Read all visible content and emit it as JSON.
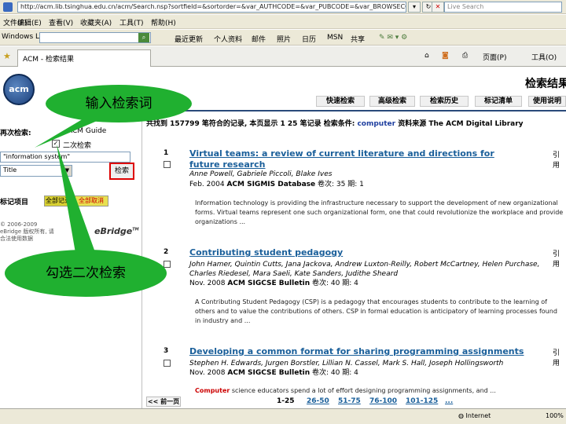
{
  "browser": {
    "url": "http://acm.lib.tsinghua.edu.cn/acm/Search.nsp?sortfield=&sortorder=&var_AUTHCODE=&var_PUBCODE=&var_BROWSECODE",
    "live_search_placeholder": "Live Search",
    "menu": [
      "文件(F)",
      "编辑(E)",
      "查看(V)",
      "收藏夹(A)",
      "工具(T)",
      "帮助(H)"
    ],
    "toolbar_brand": "Windows Live",
    "toolbar_items": [
      "最近更新",
      "个人资料",
      "邮件",
      "照片",
      "日历",
      "MSN",
      "共享"
    ],
    "tab_title": "ACM - 检索结果",
    "tab_tools": [
      "页面(P)",
      "工具(O)"
    ],
    "status_zone": "Internet",
    "status_zoom": "100%"
  },
  "header": {
    "logo": "acm",
    "page_title": "检索结果",
    "nav": [
      "快速检索",
      "高级检索",
      "检索历史",
      "标记清单",
      "使用说明"
    ]
  },
  "sidebar": {
    "search_label": "再次检索:",
    "scope_label": "ACM Guide",
    "secondary_check": "✓",
    "secondary_label": "二次检索",
    "query_value": "\"information system\"",
    "field_select": "Title",
    "search_button": "检索",
    "mark_label": "标记项目",
    "mark_all": "全部记录",
    "mark_clear": "全部取消",
    "copyright": "© 2006-2009 eBridge 版权所有, 请合法使用数据",
    "ebridge": "eBridge",
    "ebridge_tm": "TM"
  },
  "summary": {
    "prefix": "共找到 157799 笔符合的记录, 本页显示 1 25 笔记录 检索条件:",
    "term": "computer",
    "suffix": "资料来源 The ACM Digital Library"
  },
  "results": [
    {
      "num": "1",
      "title": "Virtual teams: a review of current literature and directions for future research",
      "side": "引用",
      "authors": "Anne Powell, Gabriele Piccoli, Blake Ives",
      "date": "Feb. 2004",
      "source": "ACM SIGMIS Database",
      "volume_info": "卷次: 35 期: 1",
      "abstract": "Information technology is providing the infrastructure necessary to support the development of new organizational forms. Virtual teams represent one such organizational form, one that could revolutionize the workplace and provide organizations ..."
    },
    {
      "num": "2",
      "title": "Contributing student pedagogy",
      "side": "引用",
      "authors": "John Hamer, Quintin Cutts, Jana Jackova, Andrew Luxton-Reilly, Robert McCartney, Helen Purchase, Charles Riedesel, Mara Saeli, Kate Sanders, Judithe Sheard",
      "date": "Nov. 2008",
      "source": "ACM SIGCSE Bulletin",
      "volume_info": "卷次: 40 期: 4",
      "abstract": "A Contributing Student Pedagogy (CSP) is a pedagogy that encourages students to contribute to the learning of others and to value the contributions of others. CSP in formal education is anticipatory of learning processes found in industry and ..."
    },
    {
      "num": "3",
      "title": "Developing a common format for sharing programming assignments",
      "side": "引用",
      "authors": "Stephen H. Edwards, Jurgen Borstler, Lillian N. Cassel, Mark S. Hall, Joseph Hollingsworth",
      "date": "Nov. 2008",
      "source": "ACM SIGCSE Bulletin",
      "volume_info": "卷次: 40 期: 4",
      "abstract_hl": "Computer",
      "abstract": "science educators spend a lot of effort designing programming assignments, and ..."
    }
  ],
  "pager": {
    "prev": "<< 前一页",
    "current": "1-25",
    "pages": [
      "26-50",
      "51-75",
      "76-100",
      "101-125",
      "..."
    ]
  },
  "callouts": {
    "first": "输入检索词",
    "second": "勾选二次检索"
  }
}
